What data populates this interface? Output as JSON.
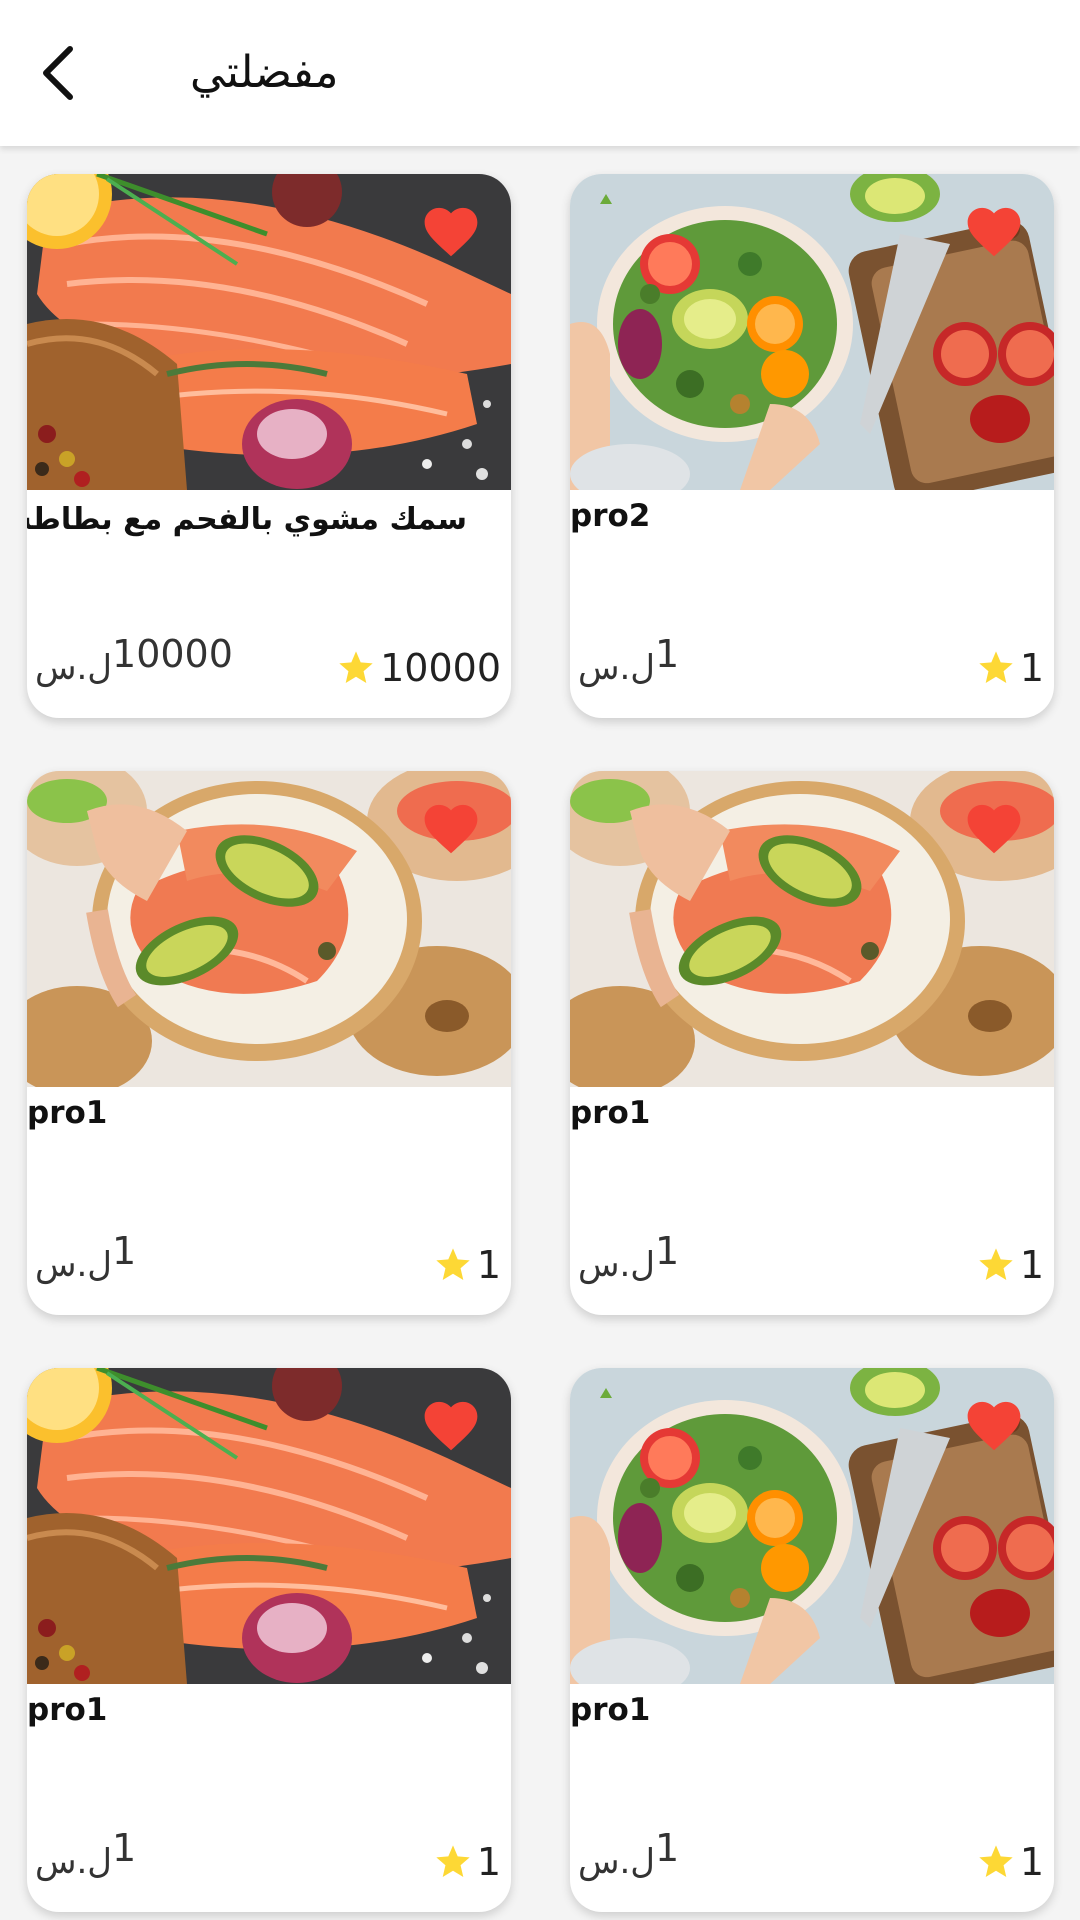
{
  "header": {
    "title": "مفضلتي"
  },
  "icons": {
    "back": "chevron-left-icon",
    "favorite": "heart-icon",
    "rating": "star-icon"
  },
  "colors": {
    "favorite": "#f44336",
    "star": "#fdd835",
    "background": "#f4f4f4"
  },
  "products": [
    {
      "name": "سمك مشوي بالفحم مع بطاطس",
      "price": "10000",
      "currency": "ل.س",
      "rating": "10000",
      "image": "salmon"
    },
    {
      "name": "pro2",
      "price": "1",
      "currency": "ل.س",
      "rating": "1",
      "image": "salad"
    },
    {
      "name": "pro1",
      "price": "1",
      "currency": "ل.س",
      "rating": "1",
      "image": "bagel"
    },
    {
      "name": "pro1",
      "price": "1",
      "currency": "ل.س",
      "rating": "1",
      "image": "bagel"
    },
    {
      "name": "pro1",
      "price": "1",
      "currency": "ل.س",
      "rating": "1",
      "image": "salmon"
    },
    {
      "name": "pro1",
      "price": "1",
      "currency": "ل.س",
      "rating": "1",
      "image": "salad"
    }
  ]
}
